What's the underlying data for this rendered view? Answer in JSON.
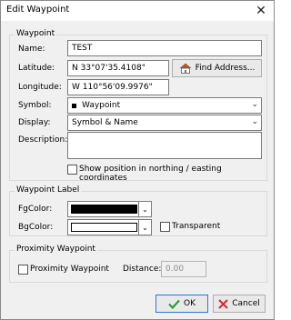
{
  "window": {
    "title": "Edit Waypoint",
    "close_glyph": "✕"
  },
  "waypoint_group": {
    "legend": "Waypoint",
    "name_label": "Name:",
    "name_value": "TEST",
    "latitude_label": "Latitude:",
    "latitude_value": "N 33°07'35.4108\"",
    "longitude_label": "Longitude:",
    "longitude_value": "W 110°56'09.9976\"",
    "find_address_label": "Find Address...",
    "symbol_label": "Symbol:",
    "symbol_value": "Waypoint",
    "display_label": "Display:",
    "display_value": "Symbol & Name",
    "description_label": "Description:",
    "description_value": "",
    "northing_label": "Show position in northing / easting coordinates",
    "northing_checked": false
  },
  "label_group": {
    "legend": "Waypoint Label",
    "fg_label": "FgColor:",
    "fg_color": "#000000",
    "bg_label": "BgColor:",
    "bg_color": "#ffffff",
    "transparent_label": "Transparent",
    "transparent_checked": false
  },
  "proximity_group": {
    "legend": "Proximity Waypoint",
    "proximity_label": "Proximity Waypoint",
    "proximity_checked": false,
    "distance_label": "Distance:",
    "distance_value": "0.00"
  },
  "buttons": {
    "ok_label": "OK",
    "cancel_label": "Cancel"
  },
  "colors": {
    "ok_check": "#2e9e3a",
    "cancel_x": "#d0303a",
    "house_roof": "#b5562c"
  }
}
